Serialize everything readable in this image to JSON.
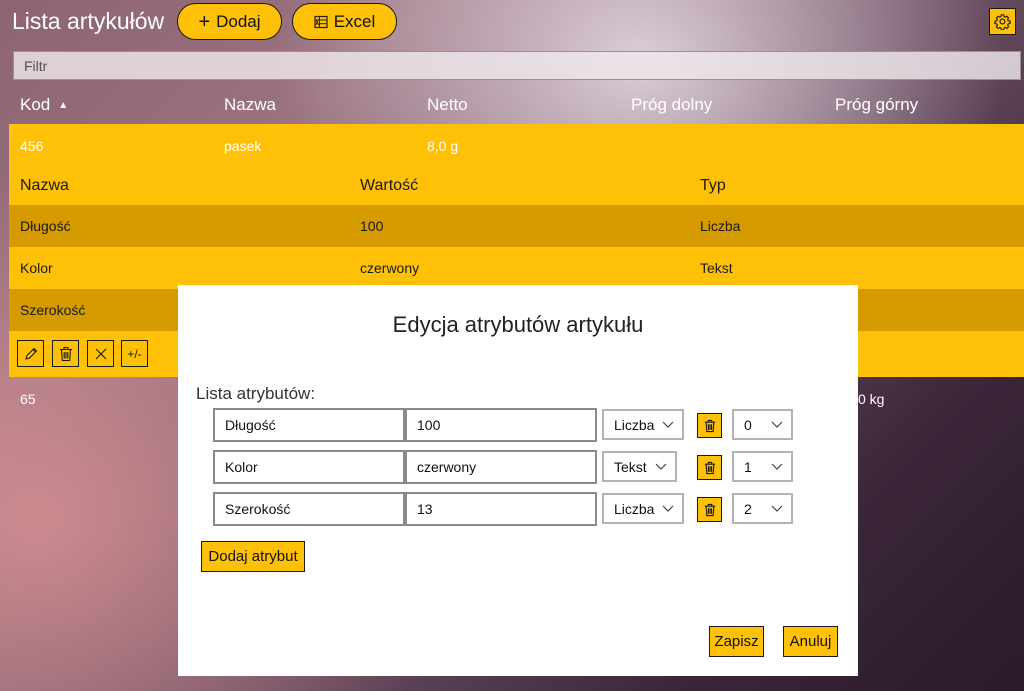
{
  "app": {
    "title": "Lista artykułów",
    "add_label": "Dodaj",
    "excel_label": "Excel",
    "filter_placeholder": "Filtr"
  },
  "columns": [
    "Kod",
    "Nazwa",
    "Netto",
    "Próg dolny",
    "Próg górny"
  ],
  "sort": {
    "column": "Kod",
    "direction": "ascending"
  },
  "items": [
    {
      "kod": "456",
      "nazwa": "pasek",
      "netto": "8,0 g",
      "expanded": true
    },
    {
      "kod": "65",
      "partial_right": "0 kg"
    }
  ],
  "attributes_table": {
    "headers": [
      "Nazwa",
      "Wartość",
      "Typ"
    ],
    "rows": [
      {
        "nazwa": "Długość",
        "wartosc": "100",
        "typ": "Liczba"
      },
      {
        "nazwa": "Kolor",
        "wartosc": "czerwony",
        "typ": "Tekst"
      },
      {
        "nazwa": "Szerokość",
        "wartosc": "",
        "typ": ""
      }
    ],
    "toolbar_plusminus": "+/-"
  },
  "dialog": {
    "title": "Edycja atrybutów artykułu",
    "list_label": "Lista atrybutów:",
    "rows": [
      {
        "name": "Długość",
        "value": "100",
        "type": "Liczba",
        "order": "0"
      },
      {
        "name": "Kolor",
        "value": "czerwony",
        "type": "Tekst",
        "order": "1"
      },
      {
        "name": "Szerokość",
        "value": "13",
        "type": "Liczba",
        "order": "2"
      }
    ],
    "add_attribute_label": "Dodaj atrybut",
    "save_label": "Zapisz",
    "cancel_label": "Anuluj"
  },
  "colors": {
    "accent": "#ffc107",
    "accent_dark": "#d49a00",
    "dialog_bg": "#ffffff"
  },
  "icons": [
    "plus-icon",
    "excel-icon",
    "gear-icon",
    "sort-up-icon",
    "edit-icon",
    "trash-icon",
    "close-icon",
    "chevron-down-icon"
  ]
}
